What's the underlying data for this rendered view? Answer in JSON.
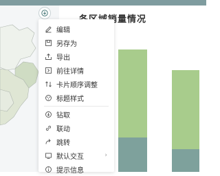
{
  "chart": {
    "title": "各区域销量情况"
  },
  "menu": {
    "items": [
      {
        "label": "编辑",
        "icon": "edit-icon"
      },
      {
        "label": "另存为",
        "icon": "save-as-icon"
      },
      {
        "label": "导出",
        "icon": "export-icon"
      },
      {
        "label": "前往详情",
        "icon": "detail-icon"
      },
      {
        "label": "卡片顺序调整",
        "icon": "reorder-icon"
      },
      {
        "label": "标题样式",
        "icon": "title-style-icon"
      },
      {
        "label": "钻取",
        "icon": "drill-icon"
      },
      {
        "label": "联动",
        "icon": "link-icon"
      },
      {
        "label": "跳转",
        "icon": "jump-icon"
      },
      {
        "label": "默认交互",
        "icon": "interaction-icon"
      },
      {
        "label": "提示信息",
        "icon": "tooltip-icon"
      }
    ]
  },
  "colors": {
    "green": "#a8cc8c",
    "teal": "#7ea19c",
    "topbar": "#7f9c9f"
  }
}
